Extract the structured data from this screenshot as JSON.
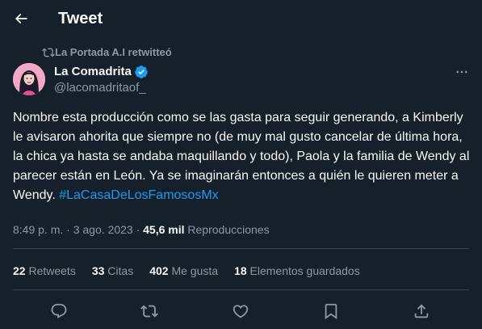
{
  "header": {
    "title": "Tweet",
    "back_icon": "arrow-left-icon"
  },
  "retweet_context": {
    "icon": "retweet-icon",
    "text": "La Portada A.I retwitteó"
  },
  "author": {
    "name": "La Comadrita",
    "handle": "@lacomadritaof_",
    "verified": true,
    "verified_color": "#1d9bf0"
  },
  "tweet": {
    "body": "Nombre esta producción como se las gasta para seguir generando, a Kimberly le avisaron ahorita que siempre no (de muy mal gusto cancelar de última hora, la chica ya hasta se andaba maquillando y todo), Paola y la familia de Wendy al parecer están en León. Ya se imaginarán entonces a quién le quieren meter a Wendy. ",
    "hashtag": "#LaCasaDeLosFamososMx"
  },
  "meta": {
    "time": "8:49 p. m.",
    "separator1": " · ",
    "date": "3 ago. 2023",
    "separator2": " · ",
    "views_count": "45,6 mil",
    "views_label": " Reproducciones"
  },
  "stats": {
    "retweets": {
      "count": "22",
      "label": " Retweets"
    },
    "quotes": {
      "count": "33",
      "label": " Citas"
    },
    "likes": {
      "count": "402",
      "label": " Me gusta"
    },
    "bookmarks": {
      "count": "18",
      "label": " Elementos guardados"
    }
  },
  "actions": {
    "reply_icon": "reply-icon",
    "retweet_icon": "retweet-icon",
    "like_icon": "heart-icon",
    "bookmark_icon": "bookmark-icon",
    "share_icon": "share-icon"
  },
  "colors": {
    "background": "#15202b",
    "text_primary": "#f7f9f9",
    "text_secondary": "#8b98a5",
    "accent": "#1d9bf0",
    "border": "#38444d"
  }
}
